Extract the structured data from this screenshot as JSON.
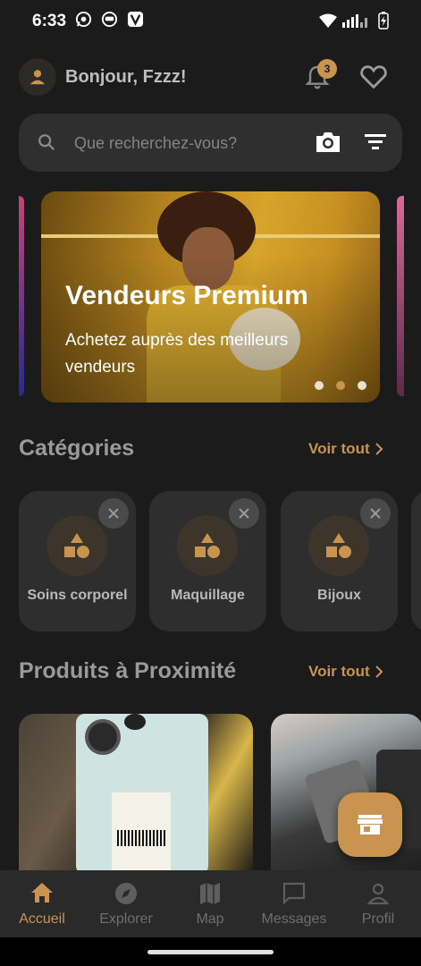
{
  "status_bar": {
    "time": "6:33",
    "icons_left": [
      "whatsapp-icon",
      "app-icon",
      "vpn-icon"
    ],
    "icons_right": [
      "wifi-icon",
      "signal-icon",
      "battery-charging-icon"
    ]
  },
  "header": {
    "greeting": "Bonjour, Fzzz!",
    "notification_count": "3"
  },
  "search": {
    "placeholder": "Que recherchez-vous?"
  },
  "banner": {
    "title": "Vendeurs Premium",
    "subtitle": "Achetez auprès des meilleurs vendeurs",
    "slide_count": 3,
    "active_slide": 2
  },
  "categories": {
    "title": "Catégories",
    "see_all": "Voir tout",
    "items": [
      {
        "label": "Soins corporel"
      },
      {
        "label": "Maquillage"
      },
      {
        "label": "Bijoux"
      }
    ]
  },
  "nearby": {
    "title": "Produits à Proximité",
    "see_all": "Voir tout"
  },
  "bottom_nav": {
    "items": [
      {
        "label": "Accueil",
        "icon": "home-icon",
        "active": true
      },
      {
        "label": "Explorer",
        "icon": "compass-icon",
        "active": false
      },
      {
        "label": "Map",
        "icon": "map-icon",
        "active": false
      },
      {
        "label": "Messages",
        "icon": "chat-icon",
        "active": false
      },
      {
        "label": "Profil",
        "icon": "person-icon",
        "active": false
      }
    ]
  },
  "colors": {
    "background": "#1b1b1b",
    "accent": "#c89450",
    "card": "#2e2e2e",
    "nav": "#2a2a2a"
  }
}
